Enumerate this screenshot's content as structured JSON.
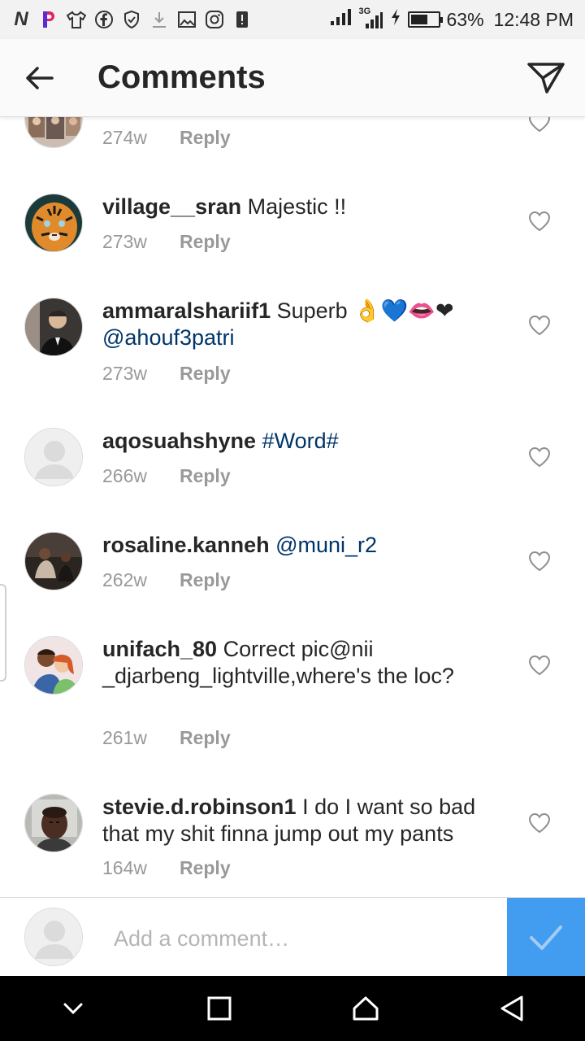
{
  "status_bar": {
    "carrier_letter": "N",
    "network": "3G",
    "battery": "63%",
    "battery_level": 0.63,
    "time": "12:48 PM"
  },
  "header": {
    "title": "Comments"
  },
  "comments": [
    {
      "username": "",
      "text": "",
      "age": "274w",
      "reply": "Reply",
      "avatar": "collage-photo"
    },
    {
      "username": "village__sran",
      "text": " Majestic !!",
      "age": "273w",
      "reply": "Reply",
      "avatar": "tiger-photo"
    },
    {
      "username": "ammaralshariif1",
      "text": " Superb 👌💙👄❤",
      "mention": "@ahouf3patri",
      "age": "273w",
      "reply": "Reply",
      "avatar": "man-in-suit-photo"
    },
    {
      "username": "aqosuahshyne",
      "hashtag": " #Word#",
      "age": "266w",
      "reply": "Reply",
      "avatar": "default-avatar"
    },
    {
      "username": "rosaline.kanneh",
      "mention": " @muni_r2",
      "age": "262w",
      "reply": "Reply",
      "avatar": "group-photo"
    },
    {
      "username": "unifach_80",
      "text": " Correct pic@nii _djarbeng_lightville,where's the loc?",
      "age": "261w",
      "reply": "Reply",
      "avatar": "cartoon-photo"
    },
    {
      "username": "stevie.d.robinson1",
      "text": " I do I want so bad that my shit finna jump out my pants",
      "age": "164w",
      "reply": "Reply",
      "avatar": "man-portrait-photo"
    }
  ],
  "compose": {
    "placeholder": "Add a comment…"
  },
  "colors": {
    "link": "#003569",
    "accent": "#3897f0",
    "muted": "#999999"
  }
}
